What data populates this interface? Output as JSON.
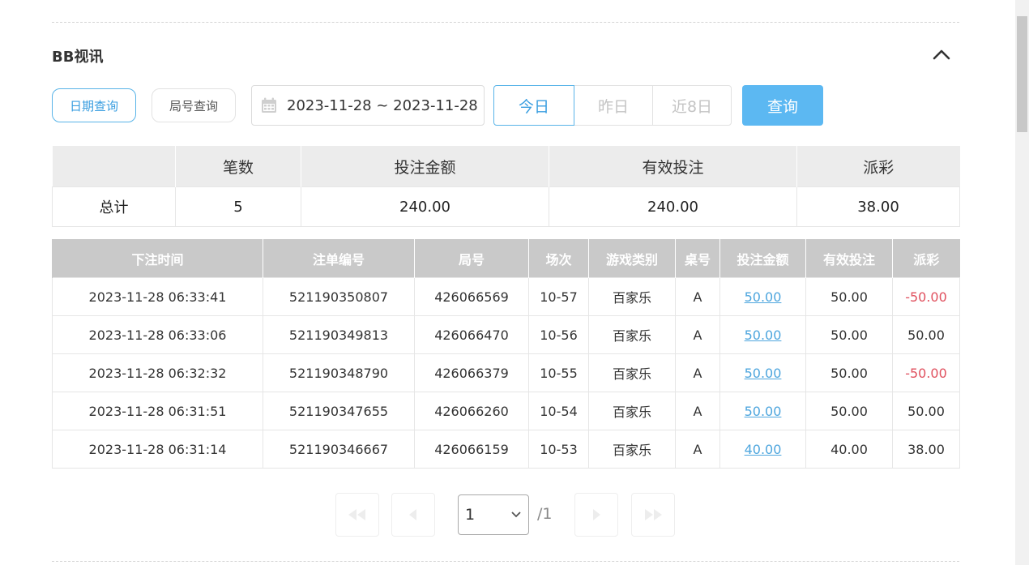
{
  "section": {
    "title": "BB视讯",
    "collapse_icon": "chevron-up-icon"
  },
  "filters": {
    "date_mode_label": "日期查询",
    "round_mode_label": "局号查询",
    "date_range": "2023-11-28 ~ 2023-11-28",
    "calendar_icon": "calendar-icon",
    "quick": [
      "今日",
      "昨日",
      "近8日"
    ],
    "query_label": "查询"
  },
  "summary": {
    "headers": [
      "",
      "笔数",
      "投注金额",
      "有效投注",
      "派彩"
    ],
    "row": [
      "总计",
      "5",
      "240.00",
      "240.00",
      "38.00"
    ]
  },
  "details": {
    "headers": [
      "下注时间",
      "注单编号",
      "局号",
      "场次",
      "游戏类别",
      "桌号",
      "投注金额",
      "有效投注",
      "派彩"
    ],
    "rows": [
      [
        "2023-11-28 06:33:41",
        "521190350807",
        "426066569",
        "10-57",
        "百家乐",
        "A",
        "50.00",
        "50.00",
        "-50.00"
      ],
      [
        "2023-11-28 06:33:06",
        "521190349813",
        "426066470",
        "10-56",
        "百家乐",
        "A",
        "50.00",
        "50.00",
        "50.00"
      ],
      [
        "2023-11-28 06:32:32",
        "521190348790",
        "426066379",
        "10-55",
        "百家乐",
        "A",
        "50.00",
        "50.00",
        "-50.00"
      ],
      [
        "2023-11-28 06:31:51",
        "521190347655",
        "426066260",
        "10-54",
        "百家乐",
        "A",
        "50.00",
        "50.00",
        "50.00"
      ],
      [
        "2023-11-28 06:31:14",
        "521190346667",
        "426066159",
        "10-53",
        "百家乐",
        "A",
        "40.00",
        "40.00",
        "38.00"
      ]
    ],
    "negative_color": "#e0505e",
    "link_color": "#4ea6de"
  },
  "pagination": {
    "current_page": "1",
    "total_label": "/1",
    "icons": [
      "first-page-icon",
      "prev-page-icon",
      "next-page-icon",
      "last-page-icon"
    ]
  },
  "colors": {
    "accent": "#59b4e8",
    "query_button": "#5cb8f2",
    "header_gray": "#c9c9c9"
  }
}
